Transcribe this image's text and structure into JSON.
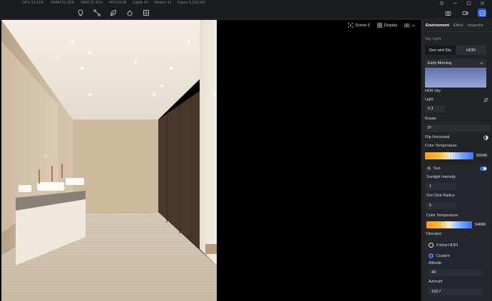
{
  "stats": {
    "gpu": "GPU 14.31%",
    "vram": "VRAM 52.33%",
    "ram": "RAM 25.41%",
    "fps": "FPS 59.96",
    "lights": "Lights 44",
    "models": "Models 41",
    "faces": "Faces 5,156,181"
  },
  "viewport": {
    "scene_label": "Scene 5",
    "display_label": "Display"
  },
  "panel": {
    "tabs": [
      "Environment",
      "Effect",
      "Inspector"
    ],
    "section_title": "Sky Light",
    "mode": {
      "options": [
        "Geo and Sky",
        "HDRI"
      ],
      "selected": "HDRI"
    },
    "preset": "Early Morning",
    "hdr_sky_label": "HDR Sky",
    "light_label": "Light",
    "light_value": "0.3",
    "rotate_label": "Rotate",
    "rotate_value": "0°",
    "flip_label": "Flip Horizontal",
    "color_temp_label": "Color Temperature",
    "color_temp_value": "6500K",
    "color_temp_fraction": 0.48,
    "sun": {
      "label": "Sun",
      "enabled": true,
      "intensity_label": "Sunlight Intensity",
      "intensity_value": "1",
      "disk_label": "Sun Disk Radius",
      "disk_value": "5",
      "color_temp_label": "Color Temperature",
      "color_temp_value": "5400K",
      "color_temp_fraction": 0.35,
      "direction_label": "Direction",
      "follow_hdri_label": "Follow HDRI",
      "custom_label": "Custom",
      "selected_direction": "Custom",
      "altitude_label": "Altitude",
      "altitude_value": "40",
      "azimuth_label": "Azimuth",
      "azimuth_value": "103.7"
    }
  },
  "colors": {
    "accent": "#2e7cf6",
    "panel_bg": "#222327",
    "viewport_bg": "#000000"
  }
}
